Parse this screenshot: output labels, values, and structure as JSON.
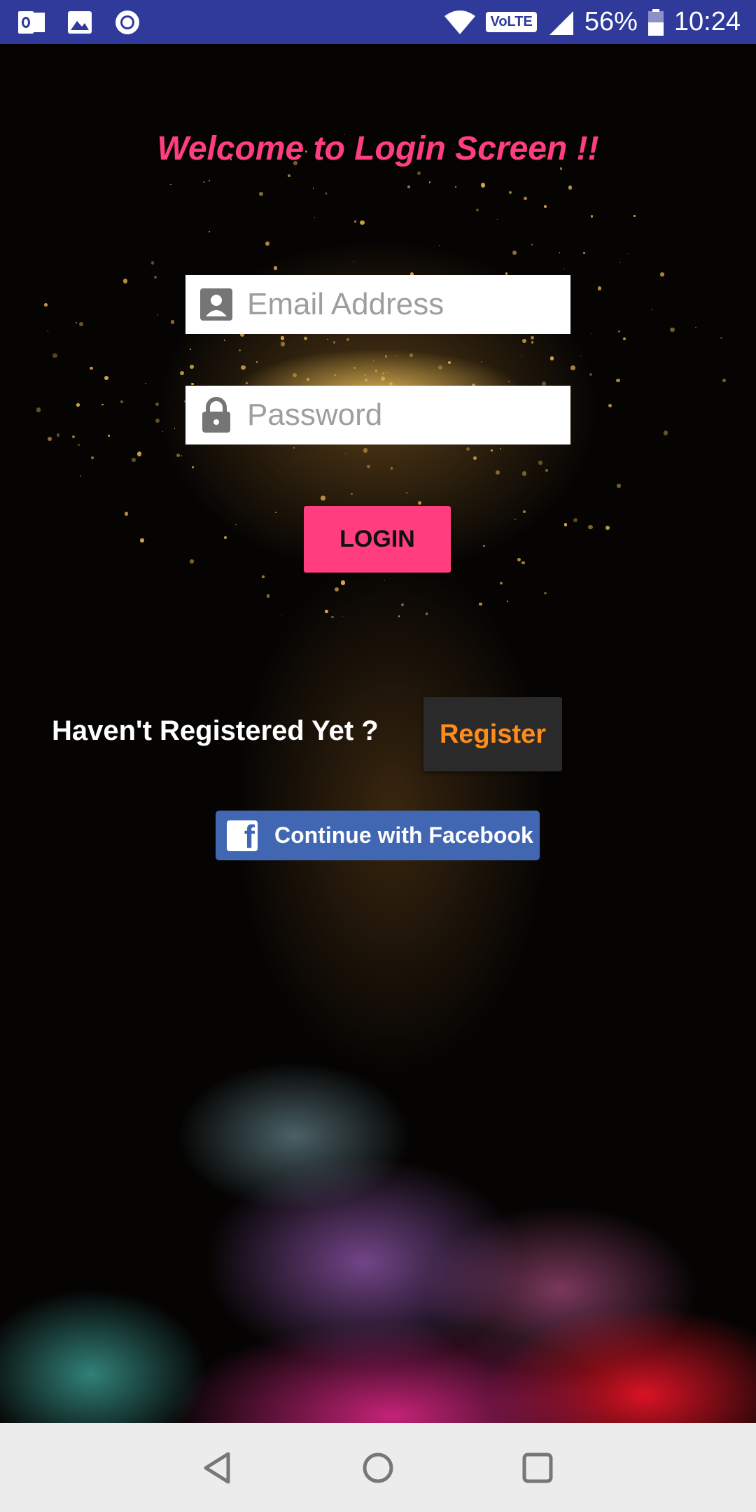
{
  "status_bar": {
    "battery": "56%",
    "time": "10:24",
    "network_badge": "VoLTE",
    "icons": [
      "outlook-icon",
      "gallery-icon",
      "circle-app-icon",
      "wifi-icon",
      "volte-icon",
      "signal-icon",
      "battery-icon"
    ]
  },
  "login": {
    "welcome_text": "Welcome to Login Screen !!",
    "email_placeholder": "Email Address",
    "password_placeholder": "Password",
    "login_label": "LOGIN"
  },
  "register": {
    "prompt_text": "Haven't Registered Yet ?",
    "register_label": "Register"
  },
  "facebook": {
    "label": "Continue with Facebook",
    "logo_letter": "f"
  },
  "colors": {
    "status_bar": "#2f3a9b",
    "accent_pink": "#ff3d7f",
    "register_orange": "#ff8c1a",
    "facebook_blue": "#4267b2",
    "nav_bar": "#ececec"
  },
  "nav_bar": {
    "buttons": [
      "back-icon",
      "home-icon",
      "recents-icon"
    ]
  }
}
